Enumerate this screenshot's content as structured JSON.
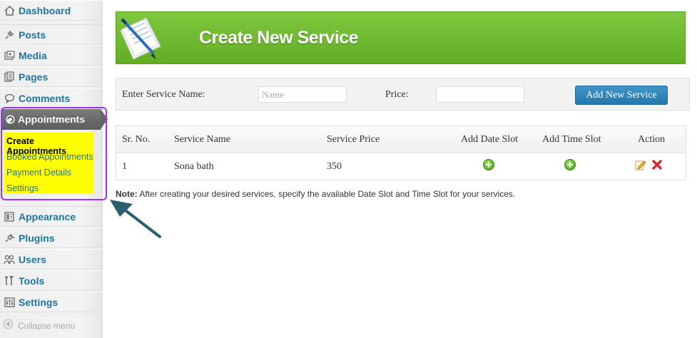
{
  "sidebar": {
    "items": [
      {
        "label": "Dashboard",
        "icon": "dashboard-icon"
      },
      {
        "label": "Posts",
        "icon": "pin-icon"
      },
      {
        "label": "Media",
        "icon": "media-icon"
      },
      {
        "label": "Pages",
        "icon": "pages-icon"
      },
      {
        "label": "Comments",
        "icon": "comment-icon"
      },
      {
        "label": "Appointments",
        "icon": "appointments-icon"
      },
      {
        "label": "Appearance",
        "icon": "appearance-icon"
      },
      {
        "label": "Plugins",
        "icon": "plug-icon"
      },
      {
        "label": "Users",
        "icon": "users-icon"
      },
      {
        "label": "Tools",
        "icon": "tools-icon"
      },
      {
        "label": "Settings",
        "icon": "settings-icon"
      }
    ],
    "submenu": [
      {
        "label": "Create Appointments"
      },
      {
        "label": "Booked Appointments"
      },
      {
        "label": "Payment Details"
      },
      {
        "label": "Settings"
      }
    ],
    "collapse_label": "Collapse menu"
  },
  "banner": {
    "title": "Create New Service"
  },
  "form": {
    "name_label": "Enter Service Name:",
    "name_placeholder": "Name",
    "price_label": "Price:",
    "price_value": "",
    "button_label": "Add New Service"
  },
  "table": {
    "headers": [
      "Sr. No.",
      "Service Name",
      "Service Price",
      "Add Date Slot",
      "Add Time Slot",
      "Action"
    ],
    "rows": [
      {
        "sr": "1",
        "name": "Sona bath",
        "price": "350"
      }
    ]
  },
  "note": {
    "prefix": "Note:",
    "text": " After creating your desired services, specify the available Date Slot and Time Slot for your services."
  },
  "colors": {
    "link_blue": "#21759b",
    "banner_green": "#6cb82e",
    "submenu_highlight": "#ffff00",
    "annotation_purple": "#9b30ff",
    "arrow_teal": "#2a5f6e"
  }
}
